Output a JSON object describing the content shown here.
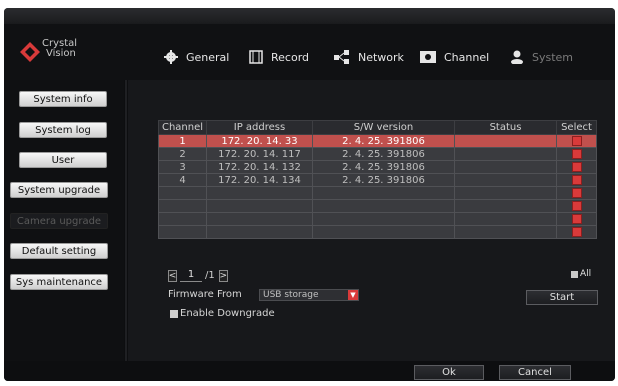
{
  "brand": {
    "line1": "Crystal",
    "line2": "Vision"
  },
  "nav": [
    {
      "label": "General",
      "icon": "gear-icon"
    },
    {
      "label": "Record",
      "icon": "film-icon"
    },
    {
      "label": "Network",
      "icon": "network-icon"
    },
    {
      "label": "Channel",
      "icon": "camera-icon"
    },
    {
      "label": "System",
      "icon": "user-icon"
    }
  ],
  "sidebar": {
    "items": [
      {
        "label": "System info"
      },
      {
        "label": "System log"
      },
      {
        "label": "User"
      },
      {
        "label": "System upgrade"
      },
      {
        "label": "Camera upgrade",
        "disabled": true
      },
      {
        "label": "Default setting"
      },
      {
        "label": "Sys maintenance"
      }
    ]
  },
  "table": {
    "headers": [
      "Channel",
      "IP address",
      "S/W version",
      "Status",
      "Select"
    ],
    "rows": [
      {
        "channel": "1",
        "ip": "172. 20. 14. 33",
        "version": "2. 4. 25. 391806",
        "status": "",
        "selected": true
      },
      {
        "channel": "2",
        "ip": "172. 20. 14. 117",
        "version": "2. 4. 25. 391806",
        "status": ""
      },
      {
        "channel": "3",
        "ip": "172. 20. 14. 132",
        "version": "2. 4. 25. 391806",
        "status": ""
      },
      {
        "channel": "4",
        "ip": "172. 20. 14. 134",
        "version": "2. 4. 25. 391806",
        "status": ""
      },
      {
        "channel": "",
        "ip": "",
        "version": "",
        "status": ""
      },
      {
        "channel": "",
        "ip": "",
        "version": "",
        "status": ""
      },
      {
        "channel": "",
        "ip": "",
        "version": "",
        "status": ""
      },
      {
        "channel": "",
        "ip": "",
        "version": "",
        "status": ""
      }
    ]
  },
  "pager": {
    "prev": "<",
    "current": "1",
    "total": "/1",
    "next": ">"
  },
  "select_all_label": "All",
  "firmware": {
    "label": "Firmware From",
    "value": "USB storage"
  },
  "downgrade_label": "Enable Downgrade",
  "buttons": {
    "start": "Start",
    "ok": "Ok",
    "cancel": "Cancel"
  },
  "colors": {
    "accent": "#d93a3a",
    "selected_row": "#c0504d"
  }
}
